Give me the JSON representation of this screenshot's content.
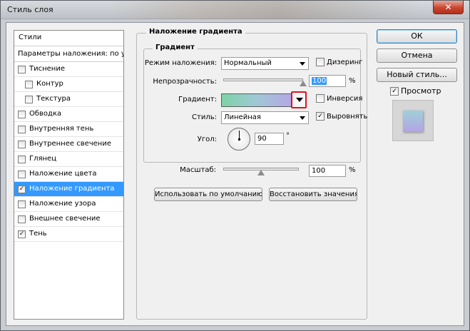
{
  "window": {
    "title": "Стиль слоя",
    "close_label": "✕"
  },
  "styles_list": {
    "header": "Стили",
    "blend_options": "Параметры наложения: по ум",
    "items": [
      {
        "label": "Тиснение",
        "checked": false,
        "indent": 0,
        "selected": false
      },
      {
        "label": "Контур",
        "checked": false,
        "indent": 1,
        "selected": false
      },
      {
        "label": "Текстура",
        "checked": false,
        "indent": 1,
        "selected": false
      },
      {
        "label": "Обводка",
        "checked": false,
        "indent": 0,
        "selected": false
      },
      {
        "label": "Внутренняя тень",
        "checked": false,
        "indent": 0,
        "selected": false
      },
      {
        "label": "Внутреннее свечение",
        "checked": false,
        "indent": 0,
        "selected": false
      },
      {
        "label": "Глянец",
        "checked": false,
        "indent": 0,
        "selected": false
      },
      {
        "label": "Наложение цвета",
        "checked": false,
        "indent": 0,
        "selected": false
      },
      {
        "label": "Наложение градиента",
        "checked": true,
        "indent": 0,
        "selected": true
      },
      {
        "label": "Наложение узора",
        "checked": false,
        "indent": 0,
        "selected": false
      },
      {
        "label": "Внешнее свечение",
        "checked": false,
        "indent": 0,
        "selected": false
      },
      {
        "label": "Тень",
        "checked": true,
        "indent": 0,
        "selected": false
      }
    ]
  },
  "gradient_overlay": {
    "group_title": "Наложение градиента",
    "subgroup_title": "Градиент",
    "blend_mode_label": "Режим наложения:",
    "blend_mode_value": "Нормальный",
    "dither_label": "Дизеринг",
    "dither_checked": false,
    "opacity_label": "Непрозрачность:",
    "opacity_value": "100",
    "opacity_unit": "%",
    "opacity_level": 1.0,
    "gradient_label": "Градиент:",
    "gradient_colors": [
      "#7ed2a6",
      "#9fc9d6",
      "#b6a6e6"
    ],
    "reverse_label": "Инверсия",
    "reverse_checked": false,
    "style_label": "Стиль:",
    "style_value": "Линейная",
    "align_label": "Выровнять",
    "align_checked": true,
    "angle_label": "Угол:",
    "angle_value": "90",
    "angle_unit": "°",
    "scale_label": "Масштаб:",
    "scale_value": "100",
    "scale_unit": "%",
    "scale_level": 0.5,
    "default_button": "Использовать по умолчанию",
    "reset_button": "Восстановить значения п"
  },
  "actions": {
    "ok": "ОК",
    "cancel": "Отмена",
    "new_style": "Новый стиль...",
    "preview_label": "Просмотр",
    "preview_checked": true
  },
  "icons": {
    "close": "close-icon",
    "checkmark": "checkmark-icon",
    "dropdown": "chevron-down-icon",
    "angle": "angle-dial-icon"
  },
  "colors": {
    "selection": "#3399ff",
    "highlight_border": "#e0121c"
  }
}
